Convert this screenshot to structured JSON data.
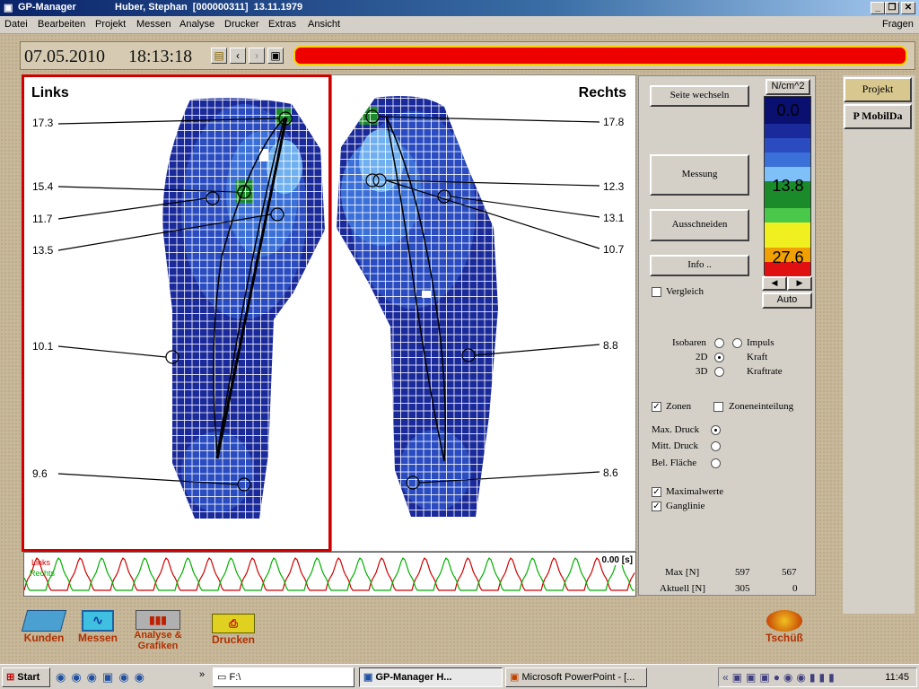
{
  "window": {
    "app_title": "GP-Manager",
    "patient": "Huber, Stephan  [000000311]  13.11.1979"
  },
  "menu": [
    "Datei",
    "Bearbeiten",
    "Projekt",
    "Messen",
    "Analyse",
    "Drucker",
    "Extras",
    "Ansicht"
  ],
  "menu_help": "Fragen",
  "toolbar": {
    "date": "07.05.2010",
    "time": "18:13:18"
  },
  "left_foot": {
    "title": "Links",
    "values": [
      "17.3",
      "15.4",
      "11.7",
      "13.5",
      "10.1",
      "9.6"
    ]
  },
  "right_foot": {
    "title": "Rechts",
    "values": [
      "17.8",
      "12.3",
      "13.1",
      "10.7",
      "8.8",
      "8.6"
    ]
  },
  "graph": {
    "label_left": "Links",
    "label_right": "Rechts",
    "time": "0.00 [s]",
    "colors": {
      "left": "#d00000",
      "right": "#00b000"
    }
  },
  "controls": {
    "seite_wechseln": "Seite wechseln",
    "messung": "Messung",
    "ausschneiden": "Ausschneiden",
    "info": "Info ..",
    "vergleich": "Vergleich",
    "unit": "N/cm^2",
    "scale_values": [
      "0.0",
      "13.8",
      "27.6"
    ],
    "auto": "Auto",
    "isobaren": "Isobaren",
    "impuls": "Impuls",
    "d2": "2D",
    "kraft": "Kraft",
    "d3": "3D",
    "kraftrate": "Kraftrate",
    "zonen": "Zonen",
    "zoneneinteilung": "Zoneneinteilung",
    "max_druck": "Max. Druck",
    "mitt_druck": "Mitt. Druck",
    "bel_flaeche": "Bel. Fläche",
    "maximalwerte": "Maximalwerte",
    "ganglinie": "Ganglinie",
    "stats": {
      "max_label": "Max [N]",
      "max_left": "597",
      "max_right": "567",
      "akt_label": "Aktuell [N]",
      "akt_left": "305",
      "akt_right": "0"
    }
  },
  "side_tabs": [
    "Projekt",
    "P MobilDa"
  ],
  "bottom_icons": [
    {
      "label": "Kunden",
      "icon": "folder-icon"
    },
    {
      "label": "Messen",
      "icon": "measure-icon"
    },
    {
      "label": "Analyse & Grafiken",
      "icon": "chart-icon"
    },
    {
      "label": "Drucken",
      "icon": "printer-icon"
    },
    {
      "label": "Tschüß",
      "icon": "exit-icon"
    }
  ],
  "taskbar": {
    "start": "Start",
    "address": "F:\\",
    "tasks": [
      "GP-Manager    H...",
      "Microsoft PowerPoint - [..."
    ],
    "clock": "11:45"
  }
}
